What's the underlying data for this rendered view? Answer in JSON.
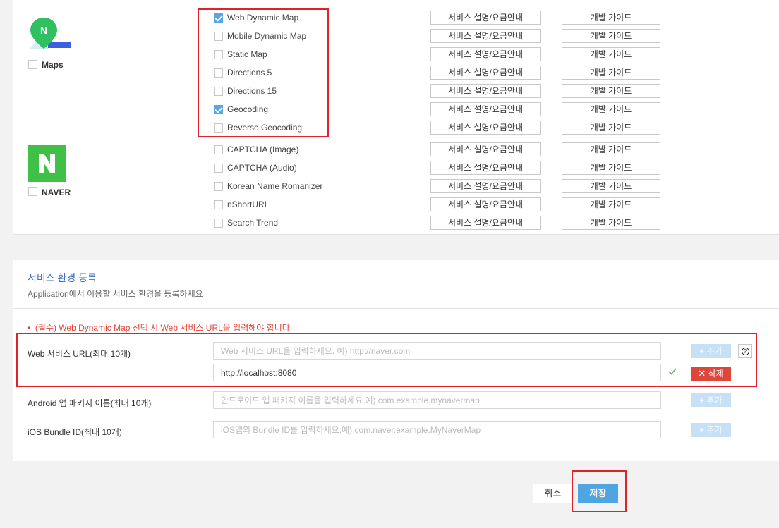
{
  "apis": {
    "maps": {
      "group_label": "Maps",
      "items": [
        {
          "label": "Web Dynamic Map",
          "checked": true
        },
        {
          "label": "Mobile Dynamic Map",
          "checked": false
        },
        {
          "label": "Static Map",
          "checked": false
        },
        {
          "label": "Directions 5",
          "checked": false
        },
        {
          "label": "Directions 15",
          "checked": false
        },
        {
          "label": "Geocoding",
          "checked": true
        },
        {
          "label": "Reverse Geocoding",
          "checked": false
        }
      ]
    },
    "naver": {
      "group_label": "NAVER",
      "items": [
        {
          "label": "CAPTCHA (Image)",
          "checked": false
        },
        {
          "label": "CAPTCHA (Audio)",
          "checked": false
        },
        {
          "label": "Korean Name Romanizer",
          "checked": false
        },
        {
          "label": "nShortURL",
          "checked": false
        },
        {
          "label": "Search Trend",
          "checked": false
        }
      ]
    },
    "service_info_label": "서비스 설명/요금안내",
    "dev_guide_label": "개발 가이드"
  },
  "env": {
    "title": "서비스 환경 등록",
    "description": "Application에서 이용할 서비스 환경을 등록하세요",
    "notice": "(필수) Web Dynamic Map 선택 시 Web 서비스 URL을 입력해야 합니다.",
    "web": {
      "label": "Web 서비스 URL(최대 10개)",
      "placeholder": "Web 서비스 URL을 입력하세요. 예) http://naver.com",
      "added_value": "http://localhost:8080",
      "add_label": "+ 추가",
      "delete_label": "삭제"
    },
    "android": {
      "label": "Android 앱 패키지 이름(최대 10개)",
      "placeholder": "안드로이드 앱 패키지 이름을 입력하세요.예) com.example.mynavermap",
      "add_label": "+ 추가"
    },
    "ios": {
      "label": "iOS Bundle ID(최대 10개)",
      "placeholder": "iOS앱의 Bundle ID를 입력하세요.예) com.naver.example.MyNaverMap",
      "add_label": "+ 추가"
    }
  },
  "footer": {
    "cancel_label": "취소",
    "save_label": "저장"
  },
  "colors": {
    "accent": "#4ea5e2",
    "danger": "#e0453a",
    "check": "#58a6e3",
    "naver_green": "#3ec146"
  }
}
